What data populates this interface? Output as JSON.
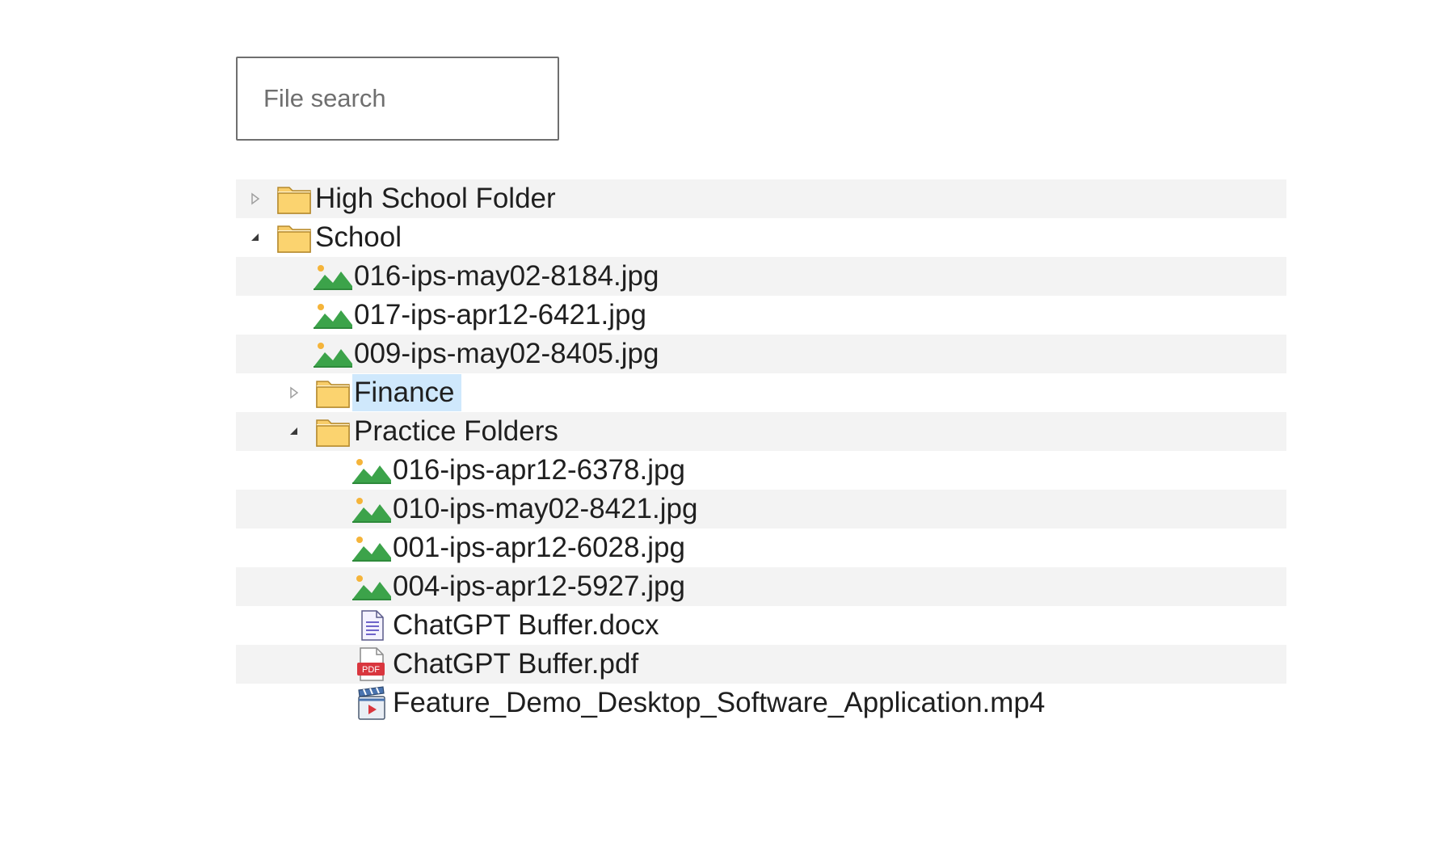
{
  "search": {
    "placeholder": "File search"
  },
  "colors": {
    "row_shade": "#f3f3f3",
    "selection": "#cfe8fc",
    "folder": "#f8cd6a",
    "image_green": "#3ca34a",
    "pdf_red": "#d9363e"
  },
  "tree": [
    {
      "label": "High School Folder",
      "type": "folder",
      "icon": "folder-icon",
      "expanded": false,
      "level": 0
    },
    {
      "label": "School",
      "type": "folder",
      "icon": "folder-icon",
      "expanded": true,
      "level": 0
    },
    {
      "label": "016-ips-may02-8184.jpg",
      "type": "image",
      "icon": "image-file-icon",
      "level": 1
    },
    {
      "label": "017-ips-apr12-6421.jpg",
      "type": "image",
      "icon": "image-file-icon",
      "level": 1
    },
    {
      "label": "009-ips-may02-8405.jpg",
      "type": "image",
      "icon": "image-file-icon",
      "level": 1
    },
    {
      "label": "Finance",
      "type": "folder",
      "icon": "folder-icon",
      "expanded": false,
      "selected": true,
      "level": 1
    },
    {
      "label": "Practice Folders",
      "type": "folder",
      "icon": "folder-icon",
      "expanded": true,
      "level": 1
    },
    {
      "label": "016-ips-apr12-6378.jpg",
      "type": "image",
      "icon": "image-file-icon",
      "level": 2
    },
    {
      "label": "010-ips-may02-8421.jpg",
      "type": "image",
      "icon": "image-file-icon",
      "level": 2
    },
    {
      "label": "001-ips-apr12-6028.jpg",
      "type": "image",
      "icon": "image-file-icon",
      "level": 2
    },
    {
      "label": "004-ips-apr12-5927.jpg",
      "type": "image",
      "icon": "image-file-icon",
      "level": 2
    },
    {
      "label": "ChatGPT Buffer.docx",
      "type": "document",
      "icon": "document-file-icon",
      "level": 2
    },
    {
      "label": "ChatGPT Buffer.pdf",
      "type": "pdf",
      "icon": "pdf-file-icon",
      "level": 2,
      "badge": "PDF"
    },
    {
      "label": "Feature_Demo_Desktop_Software_Application.mp4",
      "type": "video",
      "icon": "video-file-icon",
      "level": 2
    }
  ]
}
